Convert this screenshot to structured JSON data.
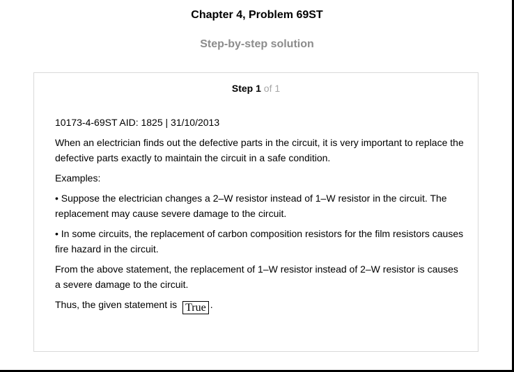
{
  "header": {
    "title": "Chapter 4, Problem 69ST",
    "subtitle": "Step-by-step solution"
  },
  "step": {
    "label": "Step",
    "number": "1",
    "of_text": "of 1"
  },
  "content": {
    "ref_line": "10173-4-69ST AID: 1825 | 31/10/2013",
    "para1": "When an electrician finds out the defective parts in the circuit, it is very important to replace the defective parts exactly to maintain the circuit in a safe condition.",
    "examples_label": "Examples:",
    "bullet1": "• Suppose the electrician changes a 2–W resistor instead of 1–W resistor in the circuit. The replacement may cause severe damage to the circuit.",
    "bullet2": "• In some circuits, the replacement of carbon composition resistors for the film resistors causes fire hazard in the circuit.",
    "para2": "From the above statement, the replacement of 1–W resistor instead of 2–W resistor is causes a severe damage to the circuit.",
    "conclusion_prefix": "Thus, the given statement is",
    "answer": "True",
    "conclusion_suffix": "."
  }
}
